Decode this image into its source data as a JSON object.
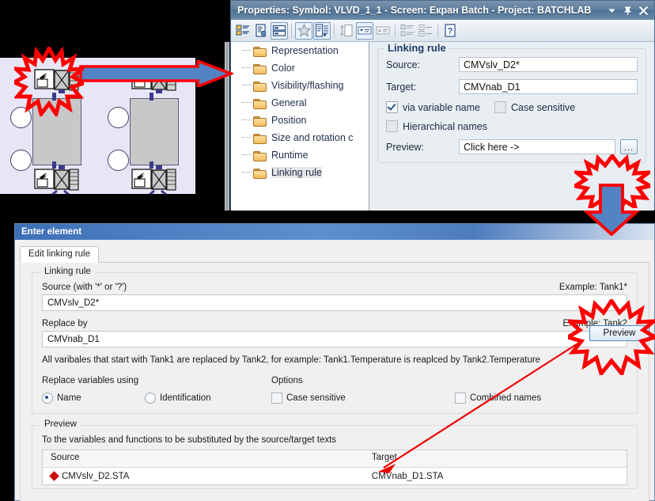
{
  "properties_window": {
    "title": "Properties: Symbol: VLVD_1_1 - Screen: Екран Batch - Project: BATCHLAB",
    "title_buttons": [
      {
        "name": "dropdown-icon",
        "glyph": "▼"
      },
      {
        "name": "pin-icon",
        "glyph": "▮"
      },
      {
        "name": "close-icon",
        "glyph": "✕"
      }
    ],
    "toolbar_icons": [
      "properties-list-icon",
      "document-properties-icon",
      "layers-icon",
      "favorites-star-icon",
      "script-list-icon",
      "height-icon",
      "dropdown-field-icon",
      "dropup-field-icon",
      "group-list-icon",
      "expand-list-icon",
      "help-icon"
    ],
    "tree": {
      "items": [
        {
          "label": "Representation",
          "selected": false
        },
        {
          "label": "Color",
          "selected": false
        },
        {
          "label": "Visibility/flashing",
          "selected": false
        },
        {
          "label": "General",
          "selected": false
        },
        {
          "label": "Position",
          "selected": false
        },
        {
          "label": "Size and rotation c",
          "selected": false
        },
        {
          "label": "Runtime",
          "selected": false
        },
        {
          "label": "Linking rule",
          "selected": true
        }
      ]
    },
    "linking_rule": {
      "group_title": "Linking rule",
      "source_label": "Source:",
      "source_value": "CMVslv_D2*",
      "target_label": "Target:",
      "target_value": "CMVnab_D1",
      "via_variable_name_label": "via variable name",
      "via_variable_name_checked": true,
      "case_sensitive_label": "Case sensitive",
      "case_sensitive_checked": false,
      "hierarchical_names_label": "Hierarchical names",
      "hierarchical_names_checked": false,
      "preview_label": "Preview:",
      "preview_value": "Click here ->",
      "browse_button_label": "..."
    }
  },
  "enter_element_dialog": {
    "title": "Enter element",
    "tab_label": "Edit linking rule",
    "linking_rule": {
      "group_title": "Linking rule",
      "source_label": "Source (with '*' or '?')",
      "source_example": "Example: Tank1*",
      "source_value": "CMVslv_D2*",
      "replace_label": "Replace by",
      "replace_example": "Example: Tank2",
      "replace_value": "CMVnab_D1",
      "preview_button_label": "Preview",
      "hint": "All varibales that start with Tank1 are replaced by Tank2, for example: Tank1.Temperature is reaplced by Tank2.Temperature",
      "replace_using_label": "Replace variables using",
      "radio_name_label": "Name",
      "radio_name_selected": true,
      "radio_identification_label": "Identification",
      "radio_identification_selected": false,
      "options_label": "Options",
      "case_sensitive_label": "Case sensitive",
      "case_sensitive_checked": false,
      "combined_names_label": "Combined names",
      "combined_names_checked": false
    },
    "preview": {
      "group_title": "Preview",
      "description": "To the variables and functions to be substituted by the source/target texts",
      "columns": [
        "Source",
        "Target"
      ],
      "rows": [
        {
          "source": "CMVslv_D2.STA",
          "target": "CMVnab_D1.STA"
        }
      ]
    }
  },
  "diagram": {
    "name": "scada-valve-diagram",
    "background_color": "#e7e6f7",
    "vessel_color": "#c8c8c8"
  },
  "annotations": {
    "colors": {
      "highlight_red": "#ff0000",
      "arrow_blue": "#5283c4",
      "thin_arrow_red": "#ee0000"
    },
    "items": [
      {
        "name": "starburst-valve-highlight"
      },
      {
        "name": "arrow-diagram-to-properties"
      },
      {
        "name": "starburst-browse-button-highlight"
      },
      {
        "name": "arrow-properties-to-dialog"
      },
      {
        "name": "starburst-preview-button-highlight"
      },
      {
        "name": "arrow-preview-to-target-column"
      }
    ]
  }
}
